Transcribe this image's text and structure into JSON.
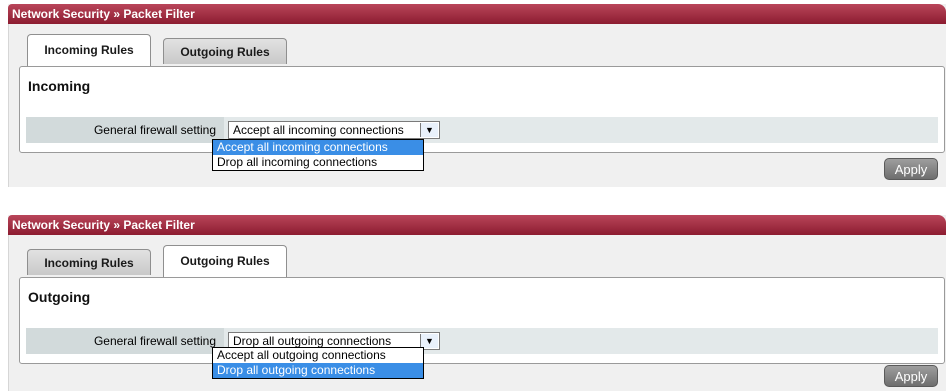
{
  "panels": [
    {
      "header": "Network Security » Packet Filter",
      "tabs": [
        "Incoming Rules",
        "Outgoing Rules"
      ],
      "active_tab": "Incoming Rules",
      "section_title": "Incoming",
      "setting_label": "General firewall setting",
      "select_value": "Accept all incoming connections",
      "options": [
        "Accept all incoming connections",
        "Drop all incoming connections"
      ],
      "highlighted_option": "Accept all incoming connections",
      "apply_label": "Apply"
    },
    {
      "header": "Network Security » Packet Filter",
      "tabs": [
        "Incoming Rules",
        "Outgoing Rules"
      ],
      "active_tab": "Outgoing Rules",
      "section_title": "Outgoing",
      "setting_label": "General firewall setting",
      "select_value": "Drop all outgoing connections",
      "options": [
        "Accept all outgoing connections",
        "Drop all outgoing connections"
      ],
      "highlighted_option": "Drop all outgoing connections",
      "apply_label": "Apply"
    }
  ],
  "icons": {
    "dropdown_arrow": "triangle-down-icon"
  },
  "colors": {
    "header_bar": "#a32d43",
    "highlight": "#3a8ee6",
    "apply_button": "#8a8a8a"
  }
}
